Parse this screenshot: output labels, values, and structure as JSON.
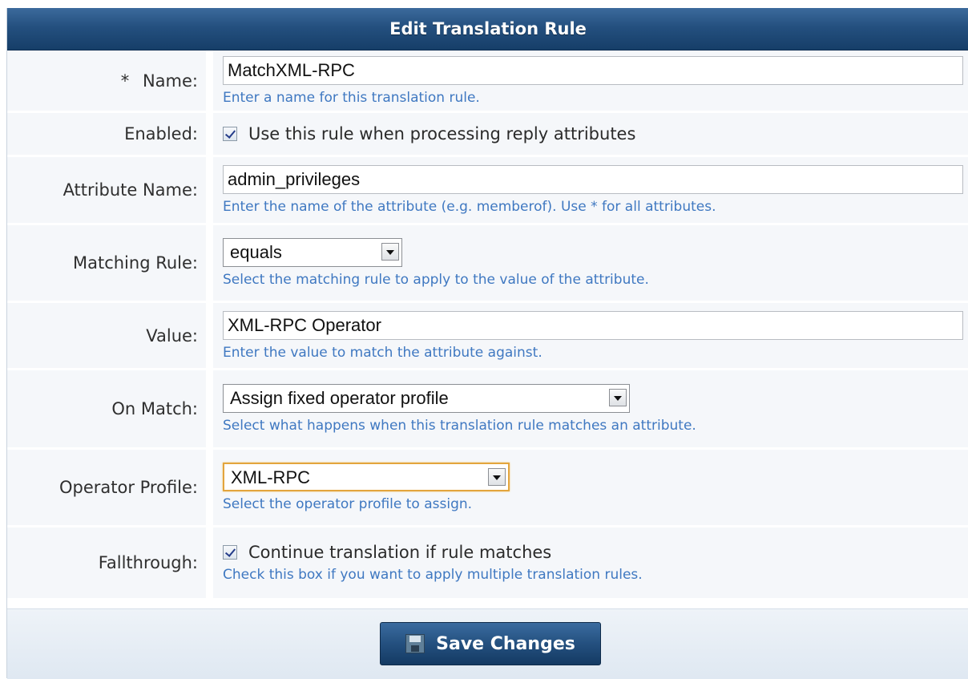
{
  "title": "Edit Translation Rule",
  "fields": {
    "name": {
      "label": "Name:",
      "required_mark": "*",
      "value": "MatchXML-RPC",
      "help": "Enter a name for this translation rule."
    },
    "enabled": {
      "label": "Enabled:",
      "checked": true,
      "text": "Use this rule when processing reply attributes"
    },
    "attribute_name": {
      "label": "Attribute Name:",
      "value": "admin_privileges",
      "help": "Enter the name of the attribute (e.g. memberof). Use * for all attributes."
    },
    "matching_rule": {
      "label": "Matching Rule:",
      "selected": "equals",
      "help": "Select the matching rule to apply to the value of the attribute."
    },
    "value": {
      "label": "Value:",
      "value": "XML-RPC Operator",
      "help": "Enter the value to match the attribute against."
    },
    "on_match": {
      "label": "On Match:",
      "selected": "Assign fixed operator profile",
      "help": "Select what happens when this translation rule matches an attribute."
    },
    "operator_profile": {
      "label": "Operator Profile:",
      "selected": "XML-RPC",
      "help": "Select the operator profile to assign."
    },
    "fallthrough": {
      "label": "Fallthrough:",
      "checked": true,
      "text": "Continue translation if rule matches",
      "help": "Check this box if you want to apply multiple translation rules."
    }
  },
  "actions": {
    "save_label": "Save Changes",
    "save_icon": "floppy-disk-icon"
  },
  "colors": {
    "header": "#24507f",
    "help_text": "#3f78c1",
    "row_bg": "#f5f7fa",
    "focus": "#e3a53d"
  }
}
